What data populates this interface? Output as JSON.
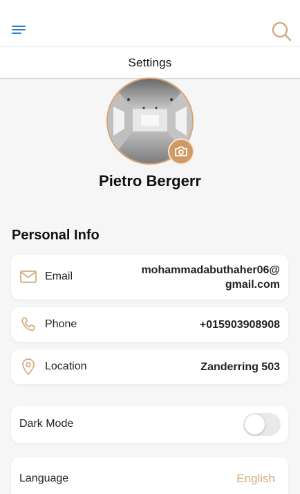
{
  "header": {
    "menu_icon": "hamburger-menu-icon",
    "search_icon": "search-icon",
    "title": "Settings"
  },
  "profile": {
    "name": "Pietro Bergerr",
    "avatar_icon": "gallery-room-photo",
    "camera_icon": "camera-icon"
  },
  "personal_info": {
    "title": "Personal Info",
    "email": {
      "icon": "envelope-icon",
      "label": "Email",
      "value_line1": "mohammadabuthaher06@",
      "value_line2": "gmail.com"
    },
    "phone": {
      "icon": "phone-icon",
      "label": "Phone",
      "value": "+015903908908"
    },
    "location": {
      "icon": "location-pin-icon",
      "label": "Location",
      "value": "Zanderring 503"
    }
  },
  "preferences": {
    "dark_mode": {
      "label": "Dark Mode",
      "enabled": false
    },
    "language": {
      "label": "Language",
      "value": "English"
    }
  },
  "colors": {
    "accent": "#d4aa7a",
    "accent_dark": "#d19a65",
    "menu_blue": "#2f7fc4",
    "background": "#f6f6f6"
  }
}
